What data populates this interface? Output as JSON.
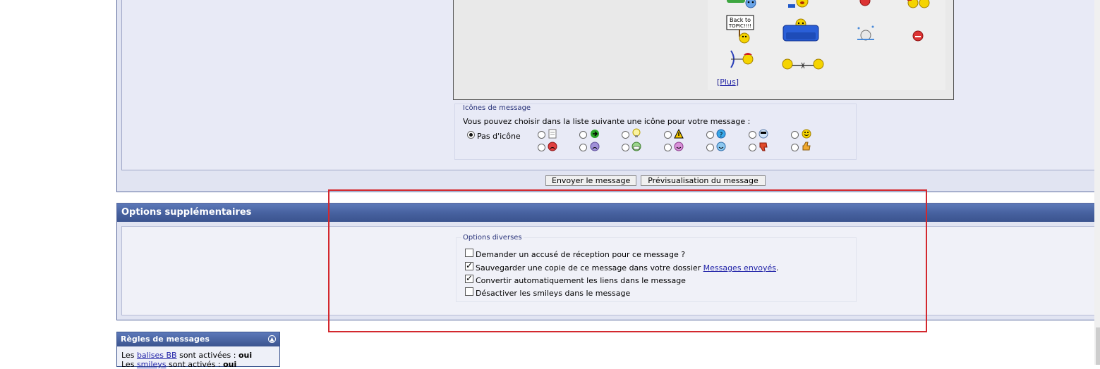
{
  "smileys": {
    "plus_open": "[",
    "plus_label": "Plus",
    "plus_close": "]",
    "sign_text_line1": "Back to",
    "sign_text_line2": "TOPIC!!!!"
  },
  "message_icons": {
    "legend": "Icônes de message",
    "prompt": "Vous pouvez choisir dans la liste suivante une icône pour votre message :",
    "no_icon_label": "Pas d'icône",
    "selected": "Pas d'icône"
  },
  "buttons": {
    "send": "Envoyer le message",
    "preview": "Prévisualisation du message"
  },
  "options": {
    "header": "Options supplémentaires",
    "legend": "Options diverses",
    "items": [
      {
        "label": "Demander un accusé de réception pour ce message ?",
        "checked": false
      },
      {
        "label_before": "Sauvegarder une copie de ce message dans votre dossier ",
        "link": "Messages envoyés",
        "label_after": ".",
        "checked": true
      },
      {
        "label": "Convertir automatiquement les liens dans le message",
        "checked": true
      },
      {
        "label": "Désactiver les smileys dans le message",
        "checked": false
      }
    ]
  },
  "rules": {
    "header": "Règles de messages",
    "toggle_icon": "collapse-icon",
    "line1_prefix": "Les ",
    "line1_link": "balises BB",
    "line1_middle": " sont activées : ",
    "line1_value": "oui",
    "line2_prefix": "Les ",
    "line2_link": "smileys",
    "line2_middle": " sont activés : ",
    "line2_value": "oui"
  },
  "colors": {
    "header_blue": "#46609e",
    "highlight_red": "#d3282e",
    "link_blue": "#2224a8"
  }
}
